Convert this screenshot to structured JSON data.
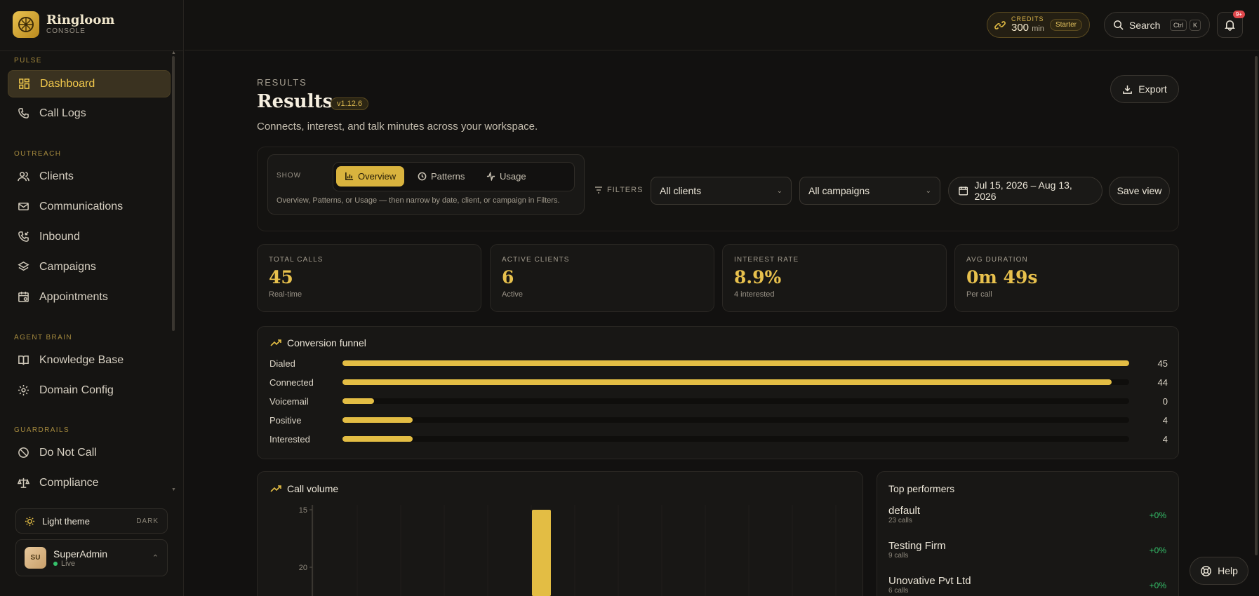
{
  "brand": {
    "name": "Ringloom",
    "sub": "CONSOLE"
  },
  "sidebar": {
    "sections": [
      "PULSE",
      "OUTREACH",
      "AGENT BRAIN",
      "GUARDRAILS"
    ],
    "items": [
      {
        "label": "Dashboard",
        "icon": "grid-icon",
        "active": true
      },
      {
        "label": "Call Logs",
        "icon": "phone-icon"
      },
      {
        "label": "Clients",
        "icon": "users-icon"
      },
      {
        "label": "Communications",
        "icon": "mail-icon"
      },
      {
        "label": "Inbound",
        "icon": "phone-incoming-icon"
      },
      {
        "label": "Campaigns",
        "icon": "layers-icon"
      },
      {
        "label": "Appointments",
        "icon": "calendar-icon"
      },
      {
        "label": "Knowledge Base",
        "icon": "book-icon"
      },
      {
        "label": "Domain Config",
        "icon": "gear-icon"
      },
      {
        "label": "Do Not Call",
        "icon": "ban-icon"
      },
      {
        "label": "Compliance",
        "icon": "scale-icon"
      }
    ],
    "theme": {
      "label": "Light theme",
      "mode": "DARK"
    },
    "user": {
      "initials": "SU",
      "name": "SuperAdmin",
      "status": "Live"
    }
  },
  "topbar": {
    "credits": {
      "label": "CREDITS",
      "value": "300",
      "unit": "min",
      "plan": "Starter"
    },
    "search": {
      "label": "Search",
      "kbd1": "Ctrl",
      "kbd2": "K"
    },
    "notifications_badge": "9+"
  },
  "header": {
    "eyebrow": "RESULTS",
    "title": "Results",
    "version": "v1.12.6",
    "subtitle": "Connects, interest, and talk minutes across your workspace.",
    "export_label": "Export"
  },
  "filters": {
    "show_label": "SHOW",
    "tabs": [
      "Overview",
      "Patterns",
      "Usage"
    ],
    "help": "Overview, Patterns, or Usage — then narrow by date, client, or campaign in Filters.",
    "filters_label": "FILTERS",
    "client_select": "All clients",
    "campaign_select": "All campaigns",
    "date_range": "Jul 15, 2026 – Aug 13, 2026",
    "save_view": "Save view"
  },
  "kpis": [
    {
      "label": "TOTAL CALLS",
      "value": "45",
      "sub": "Real-time"
    },
    {
      "label": "ACTIVE CLIENTS",
      "value": "6",
      "sub": "Active"
    },
    {
      "label": "INTEREST RATE",
      "value": "8.9%",
      "sub": "4 interested"
    },
    {
      "label": "AVG DURATION",
      "value": "0m 49s",
      "sub": "Per call"
    }
  ],
  "funnel": {
    "title": "Conversion funnel",
    "max": 45,
    "rows": [
      {
        "label": "Dialed",
        "value": 45,
        "fraction": 1.0
      },
      {
        "label": "Connected",
        "value": 44,
        "fraction": 0.978
      },
      {
        "label": "Voicemail",
        "value": 0,
        "fraction": 0.04
      },
      {
        "label": "Positive",
        "value": 4,
        "fraction": 0.089
      },
      {
        "label": "Interested",
        "value": 4,
        "fraction": 0.089
      }
    ]
  },
  "call_volume": {
    "title": "Call volume",
    "y_ticks": [
      "20",
      "15"
    ]
  },
  "chart_data": {
    "type": "bar",
    "title": "Call volume",
    "ylim": [
      0,
      20
    ],
    "y_ticks": [
      15,
      20
    ],
    "values": [
      20
    ]
  },
  "top_performers": {
    "title": "Top performers",
    "rows": [
      {
        "name": "default",
        "calls": "23 calls",
        "delta": "+0%"
      },
      {
        "name": "Testing Firm",
        "calls": "9 calls",
        "delta": "+0%"
      },
      {
        "name": "Unovative Pvt Ltd",
        "calls": "6 calls",
        "delta": "+0%"
      }
    ]
  },
  "help_label": "Help",
  "colors": {
    "accent": "#E3BD44",
    "positive": "#35C26B",
    "badge": "#E0484C"
  }
}
